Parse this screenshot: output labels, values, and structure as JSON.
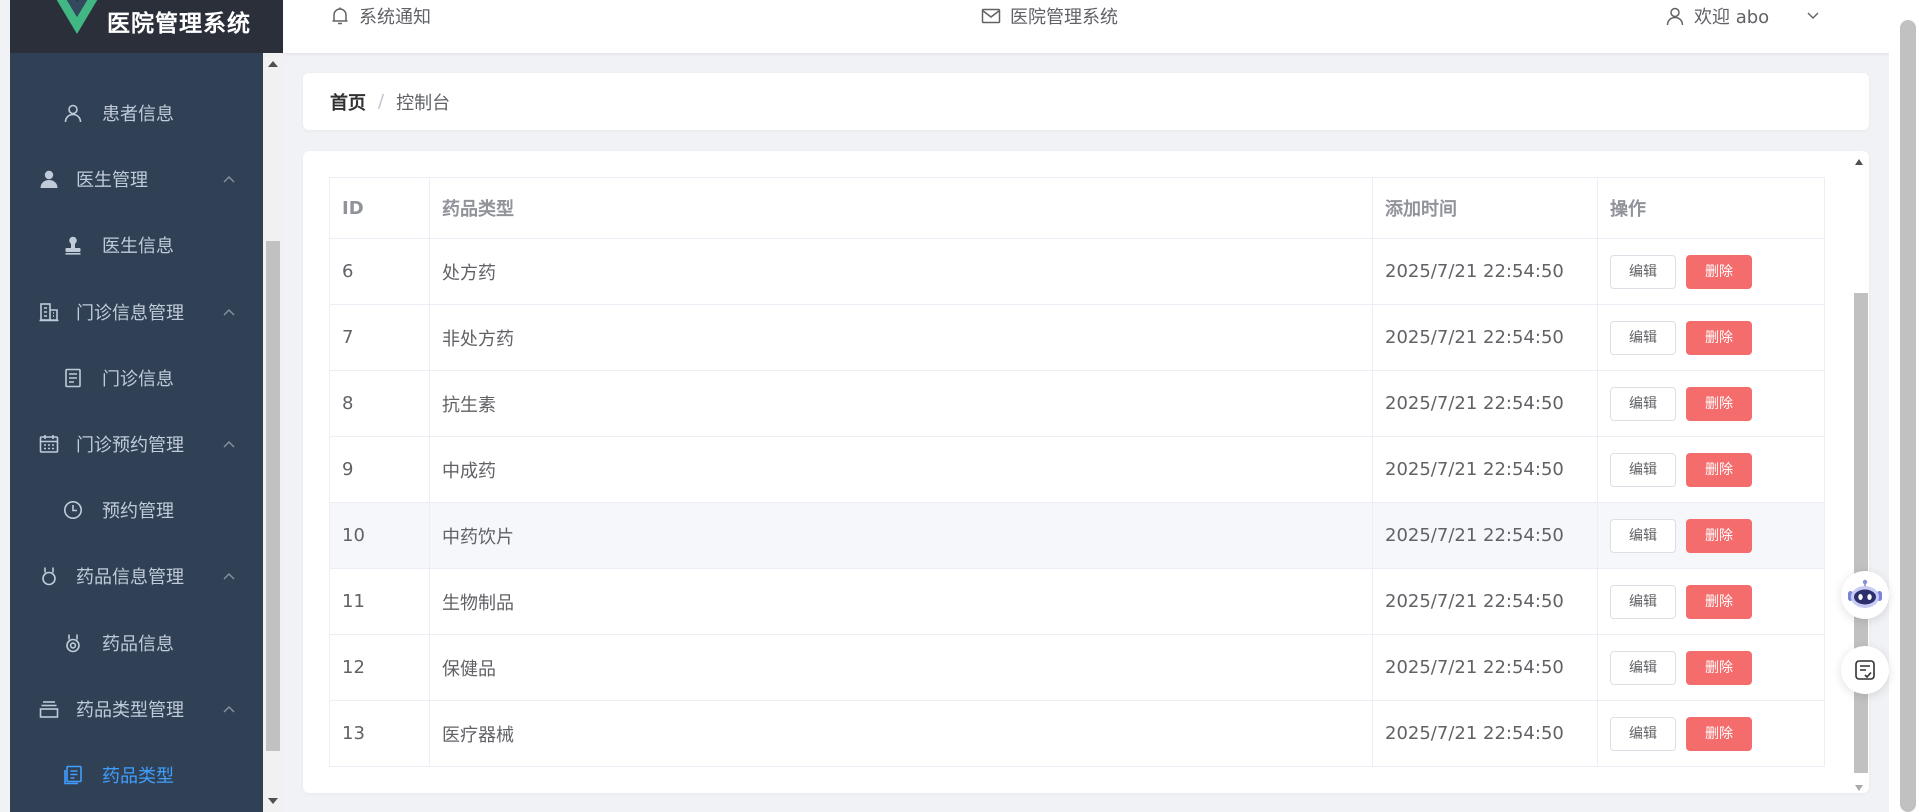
{
  "app": {
    "title": "医院管理系统",
    "logo_icon": "vue-logo-icon"
  },
  "sidebar": {
    "items": [
      {
        "label": "患者信息",
        "icon": "user-outline-icon",
        "level": 2
      },
      {
        "label": "医生管理",
        "icon": "user-filled-icon",
        "level": 1,
        "arrow": "^"
      },
      {
        "label": "医生信息",
        "icon": "stamp-icon",
        "level": 2
      },
      {
        "label": "门诊信息管理",
        "icon": "office-building-icon",
        "level": 1,
        "arrow": "^"
      },
      {
        "label": "门诊信息",
        "icon": "document-icon",
        "level": 2
      },
      {
        "label": "门诊预约管理",
        "icon": "calendar-icon",
        "level": 1,
        "arrow": "^"
      },
      {
        "label": "预约管理",
        "icon": "clock-icon",
        "level": 2
      },
      {
        "label": "药品信息管理",
        "icon": "medal-icon",
        "level": 1,
        "arrow": "^"
      },
      {
        "label": "药品信息",
        "icon": "medal-icon",
        "level": 2
      },
      {
        "label": "药品类型管理",
        "icon": "box-icon",
        "level": 1,
        "arrow": "^"
      },
      {
        "label": "药品类型",
        "icon": "tickets-icon",
        "level": 2,
        "active": true
      }
    ]
  },
  "header": {
    "notice": "系统通知",
    "system": "医院管理系统",
    "user": "欢迎 abo"
  },
  "breadcrumb": {
    "home": "首页",
    "separator": "/",
    "current": "控制台"
  },
  "table": {
    "columns": [
      "ID",
      "药品类型",
      "添加时间",
      "操作"
    ],
    "edit_label": "编辑",
    "delete_label": "删除",
    "rows": [
      {
        "id": "6",
        "type": "处方药",
        "time": "2025/7/21 22:54:50"
      },
      {
        "id": "7",
        "type": "非处方药",
        "time": "2025/7/21 22:54:50"
      },
      {
        "id": "8",
        "type": "抗生素",
        "time": "2025/7/21 22:54:50"
      },
      {
        "id": "9",
        "type": "中成药",
        "time": "2025/7/21 22:54:50"
      },
      {
        "id": "10",
        "type": "中药饮片",
        "time": "2025/7/21 22:54:50",
        "highlight": true
      },
      {
        "id": "11",
        "type": "生物制品",
        "time": "2025/7/21 22:54:50"
      },
      {
        "id": "12",
        "type": "保健品",
        "time": "2025/7/21 22:54:50"
      },
      {
        "id": "13",
        "type": "医疗器械",
        "time": "2025/7/21 22:54:50"
      }
    ]
  },
  "colors": {
    "sidebar_bg": "#304156",
    "sidebar_text": "#bfcbd9",
    "active": "#409eff",
    "danger": "#f56c6c"
  }
}
